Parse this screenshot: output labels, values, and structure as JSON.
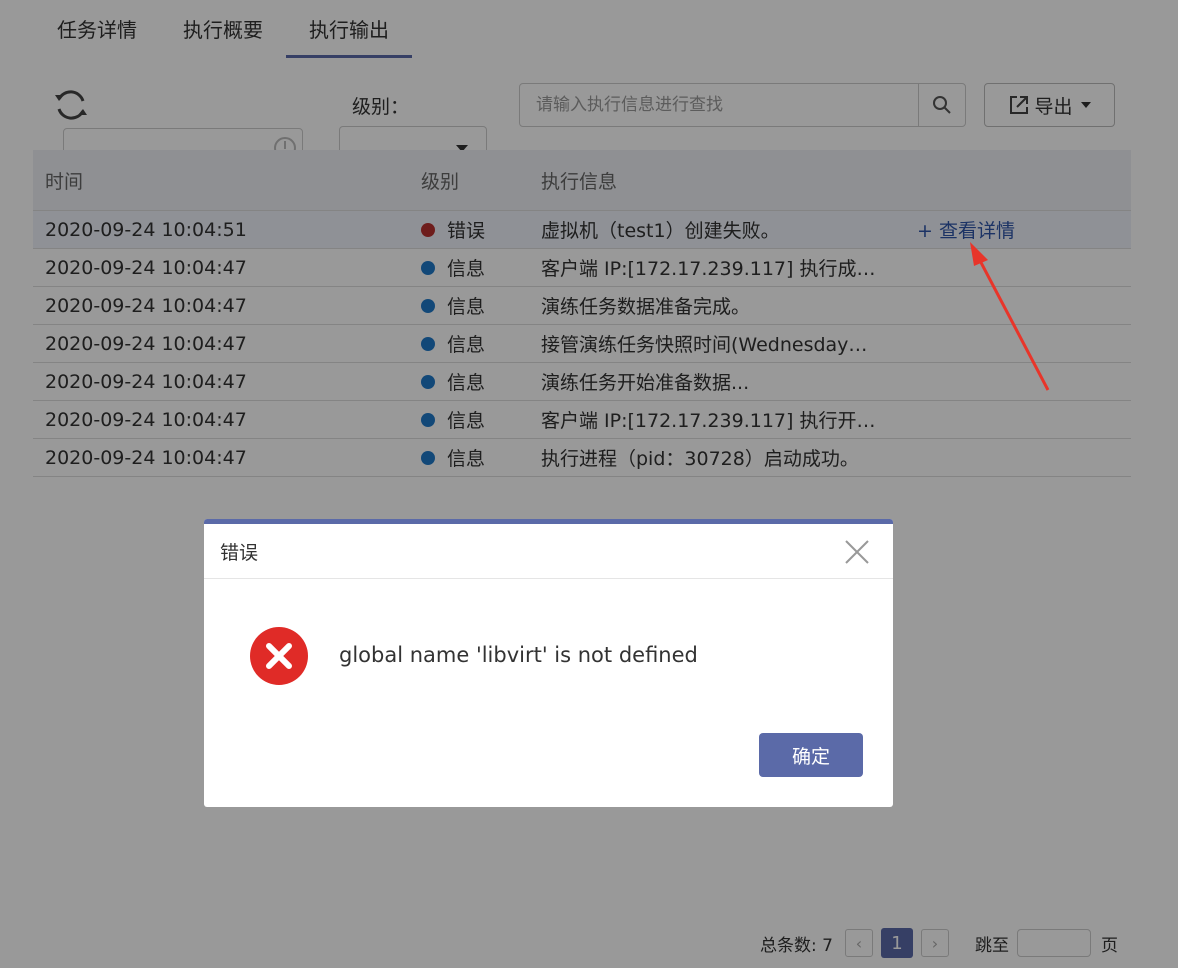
{
  "tabs": [
    {
      "label": "任务详情",
      "active": false
    },
    {
      "label": "执行概要",
      "active": false
    },
    {
      "label": "执行输出",
      "active": true
    }
  ],
  "toolbar": {
    "level_label": "级别：",
    "level_value": "",
    "search_placeholder": "请输入执行信息进行查找",
    "export_label": "导出"
  },
  "table": {
    "headers": {
      "time": "时间",
      "level": "级别",
      "info": "执行信息"
    },
    "detail_link": "+ 查看详情",
    "rows": [
      {
        "time": "2020-09-24 10:04:51",
        "level": "错误",
        "level_color": "#b8312f",
        "info": "虚拟机（test1）创建失败。"
      },
      {
        "time": "2020-09-24 10:04:47",
        "level": "信息",
        "level_color": "#1f78c8",
        "info": "客户端 IP:[172.17.239.117] 执行成…"
      },
      {
        "time": "2020-09-24 10:04:47",
        "level": "信息",
        "level_color": "#1f78c8",
        "info": "演练任务数据准备完成。"
      },
      {
        "time": "2020-09-24 10:04:47",
        "level": "信息",
        "level_color": "#1f78c8",
        "info": "接管演练任务快照时间(Wednesday…"
      },
      {
        "time": "2020-09-24 10:04:47",
        "level": "信息",
        "level_color": "#1f78c8",
        "info": "演练任务开始准备数据..."
      },
      {
        "time": "2020-09-24 10:04:47",
        "level": "信息",
        "level_color": "#1f78c8",
        "info": "客户端 IP:[172.17.239.117] 执行开…"
      },
      {
        "time": "2020-09-24 10:04:47",
        "level": "信息",
        "level_color": "#1f78c8",
        "info": "执行进程（pid：30728）启动成功。"
      }
    ]
  },
  "pagination": {
    "total_label": "总条数: 7",
    "current_page": "1",
    "jump_label": "跳至",
    "page_unit": "页"
  },
  "modal": {
    "title": "错误",
    "message": "global name 'libvirt' is not defined",
    "ok_label": "确定"
  },
  "colors": {
    "accent": "#5b6aa8",
    "error": "#e02b27",
    "info": "#1f78c8",
    "link": "#2f56a8",
    "annotation": "#e8352a"
  }
}
